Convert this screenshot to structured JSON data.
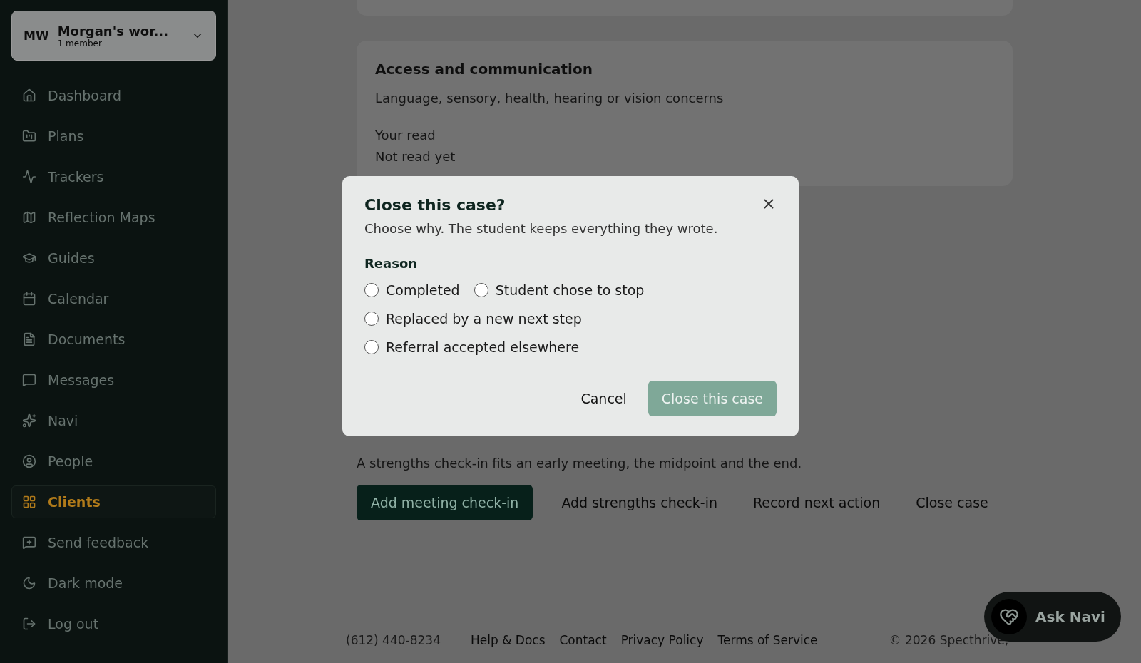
{
  "workspace": {
    "initials": "MW",
    "name": "Morgan's wor...",
    "members": "1 member"
  },
  "sidebar": {
    "items": [
      {
        "label": "Dashboard",
        "selected": false
      },
      {
        "label": "Plans",
        "selected": false
      },
      {
        "label": "Trackers",
        "selected": false
      },
      {
        "label": "Reflection Maps",
        "selected": false
      },
      {
        "label": "Guides",
        "selected": false
      },
      {
        "label": "Calendar",
        "selected": false
      },
      {
        "label": "Documents",
        "selected": false
      },
      {
        "label": "Messages",
        "selected": false
      },
      {
        "label": "Navi",
        "selected": false
      },
      {
        "label": "People",
        "selected": false
      },
      {
        "label": "Clients",
        "selected": true
      },
      {
        "label": "Send feedback",
        "selected": false
      },
      {
        "label": "Dark mode",
        "selected": false
      },
      {
        "label": "Log out",
        "selected": false
      }
    ]
  },
  "access_card": {
    "title": "Access and communication",
    "description": "Language, sensory, health, hearing or vision concerns",
    "read_label": "Your read",
    "read_value": "Not read yet"
  },
  "strengths_note": "A strengths check-in fits an early meeting, the midpoint and the end.",
  "actions": [
    {
      "label": "Add meeting check-in",
      "primary": true
    },
    {
      "label": "Add strengths check-in",
      "primary": false
    },
    {
      "label": "Record next action",
      "primary": false
    },
    {
      "label": "Close case",
      "primary": false
    }
  ],
  "footer": {
    "phone": "(612) 440-8234",
    "links": [
      "Help & Docs",
      "Contact",
      "Privacy Policy",
      "Terms of Service"
    ],
    "copyright": "© 2026 Specthrive,"
  },
  "ask_navi": {
    "label": "Ask Navi"
  },
  "dialog": {
    "title": "Close this case?",
    "subtitle": "Choose why. The student keeps everything they wrote.",
    "reason_label": "Reason",
    "options": [
      {
        "label": "Completed",
        "selected": false
      },
      {
        "label": "Student chose to stop",
        "selected": false
      },
      {
        "label": "Replaced by a new next step",
        "selected": false
      },
      {
        "label": "Referral accepted elsewhere",
        "selected": false
      }
    ],
    "cancel": "Cancel",
    "confirm": "Close this case"
  }
}
